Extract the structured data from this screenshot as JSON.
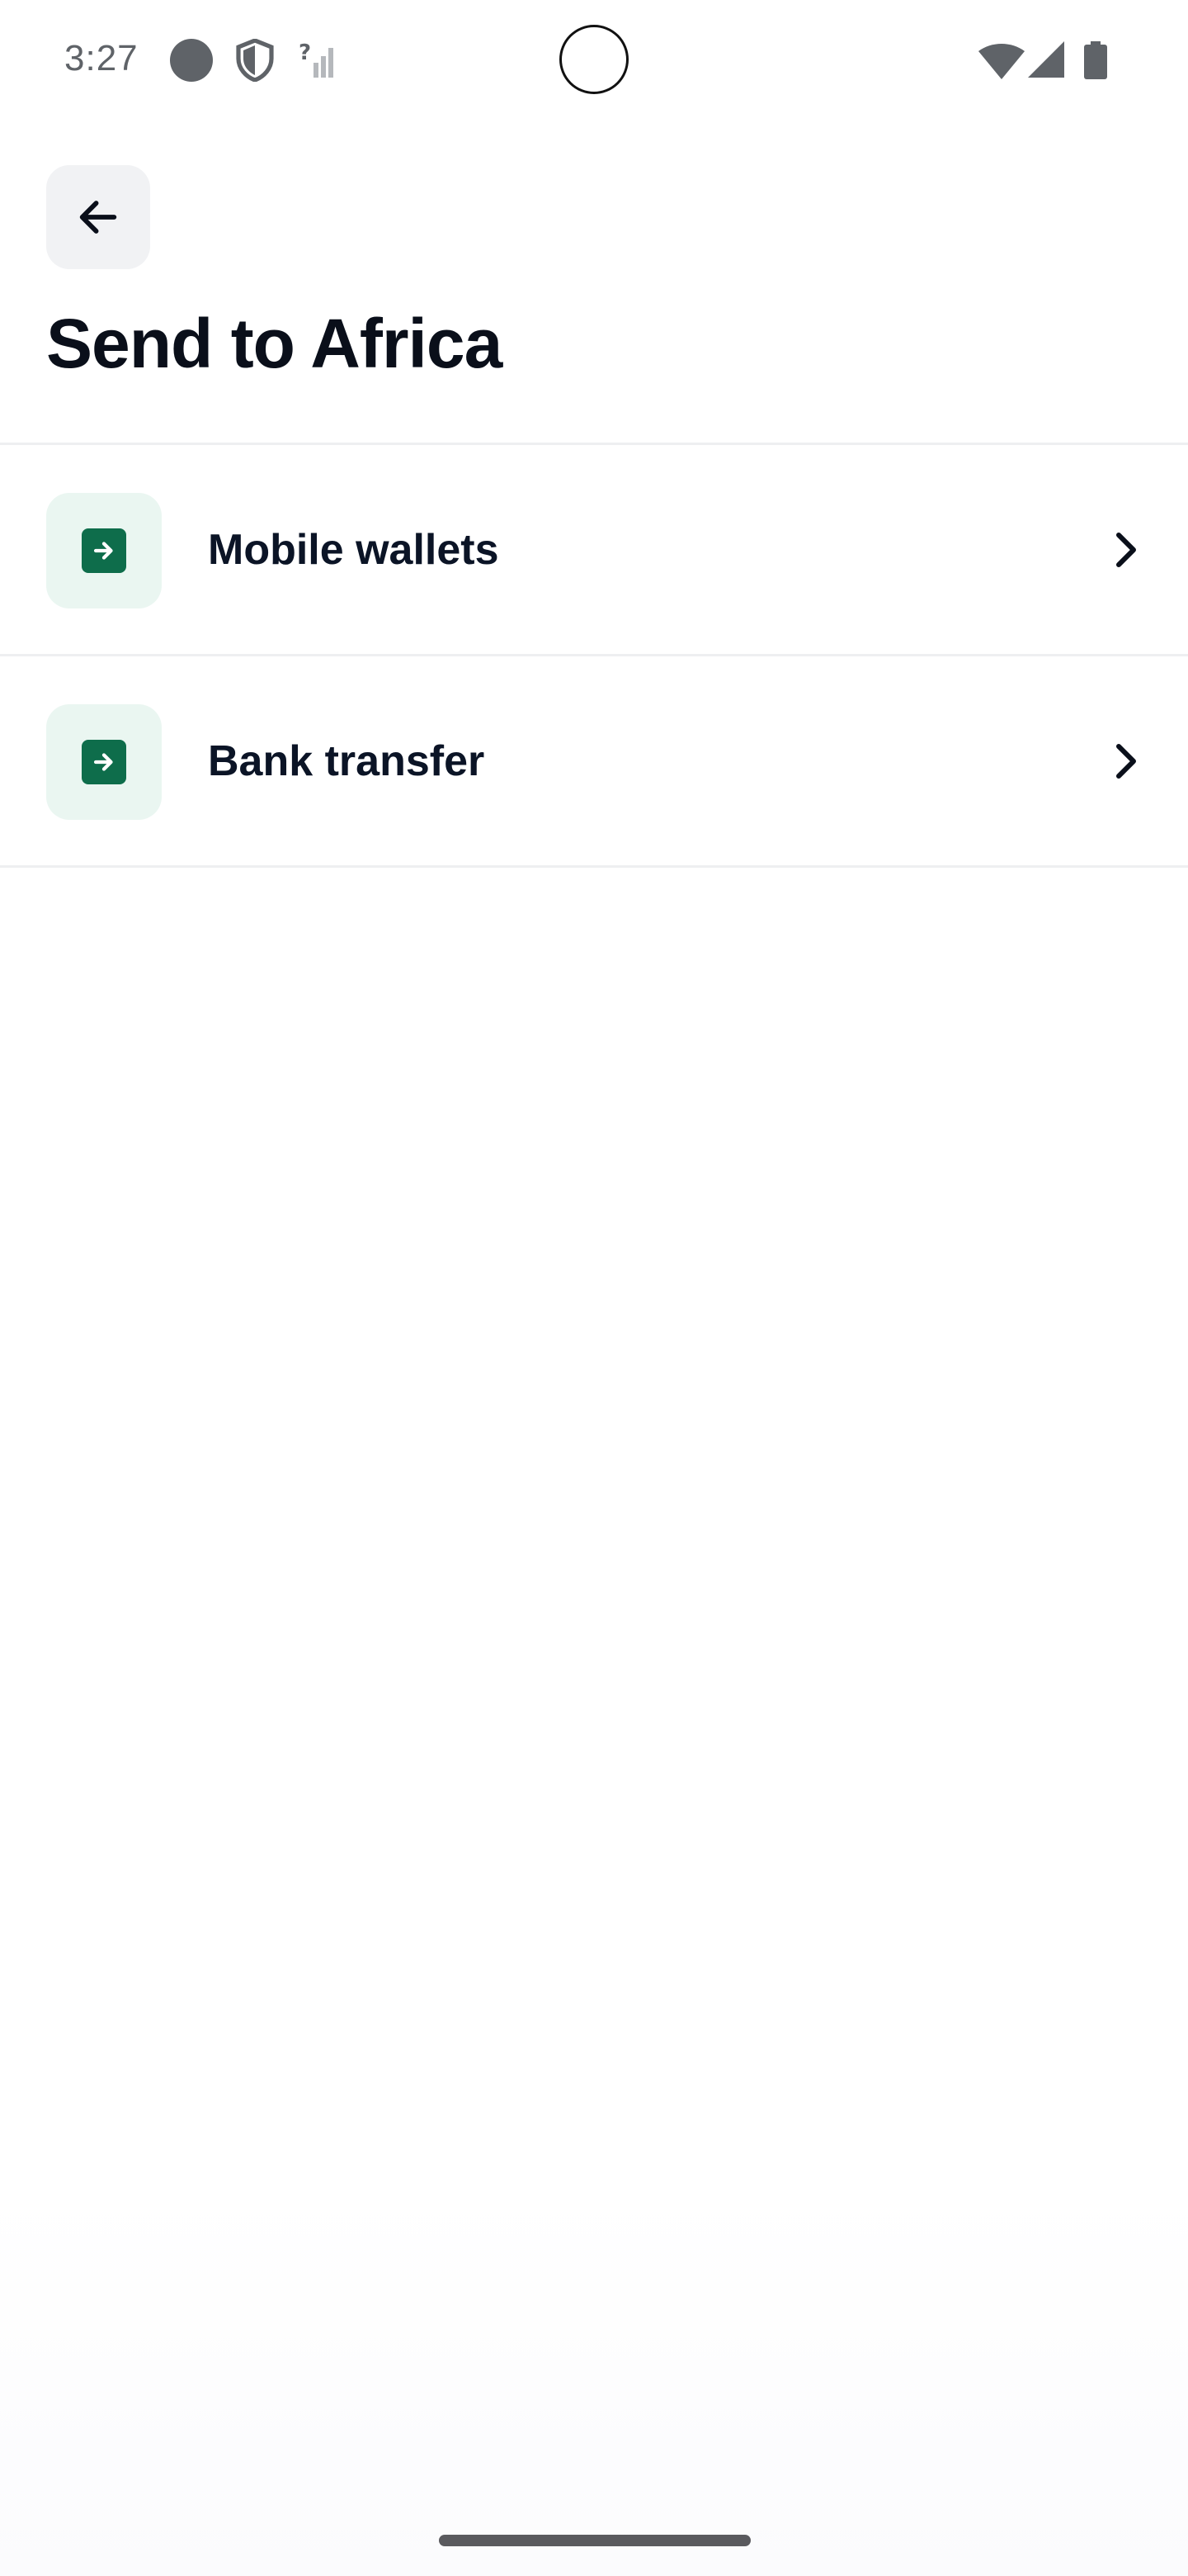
{
  "status_bar": {
    "time": "3:27"
  },
  "header": {
    "back_icon": "arrow-left-icon",
    "title": "Send to Africa"
  },
  "options": [
    {
      "label": "Mobile wallets",
      "icon": "arrow-right-square-icon",
      "chevron": "chevron-right-icon"
    },
    {
      "label": "Bank transfer",
      "icon": "arrow-right-square-icon",
      "chevron": "chevron-right-icon"
    }
  ],
  "colors": {
    "accent": "#0e6d4b",
    "icon_bg": "#eaf6f1",
    "back_button_bg": "#f1f2f4",
    "text": "#0b1426"
  }
}
